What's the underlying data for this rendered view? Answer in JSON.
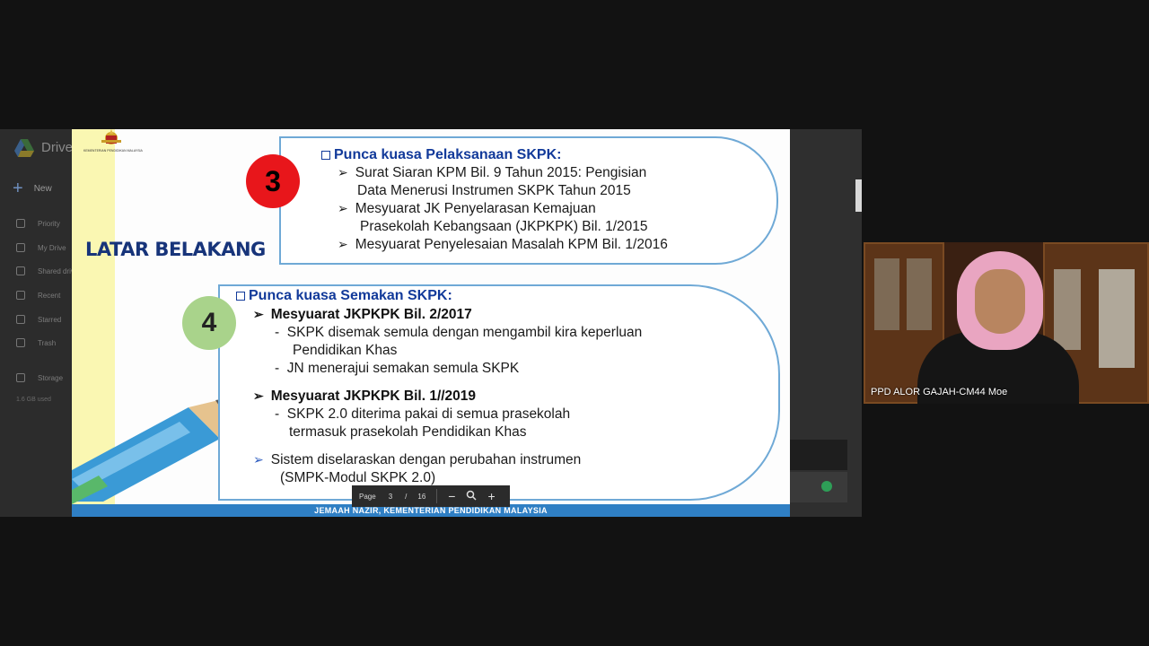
{
  "drive": {
    "title": "Drive",
    "new_label": "New",
    "sidebar": [
      "Priority",
      "My Drive",
      "Shared drives",
      "Recent",
      "Starred",
      "Trash",
      "Storage"
    ],
    "storage_used": "1.6 GB used"
  },
  "slide": {
    "footer": "JEMAAH NAZIR,  KEMENTERIAN PENDIDIKAN MALAYSIA",
    "side_title": "LATAR BELAKANG",
    "crest_text": "KEMENTERIAN PENDIDIKAN MALAYSIA",
    "section3": {
      "number": "3",
      "heading": "Punca kuasa Pelaksanaan SKPK:",
      "items": [
        [
          "Surat Siaran KPM Bil. 9 Tahun 2015: Pengisian",
          "Data Menerusi Instrumen SKPK Tahun 2015"
        ],
        [
          "Mesyuarat JK Penyelarasan Kemajuan",
          "Prasekolah Kebangsaan (JKPKPK) Bil. 1/2015"
        ],
        [
          "Mesyuarat Penyelesaian Masalah KPM Bil. 1/2016"
        ]
      ]
    },
    "section4": {
      "number": "4",
      "heading": "Punca kuasa Semakan SKPK:",
      "meeting1": "Mesyuarat JKPKPK Bil. 2/2017",
      "meeting1_points": [
        [
          "SKPK disemak semula dengan mengambil kira keperluan",
          "Pendidikan Khas"
        ],
        [
          "JN menerajui semakan semula SKPK"
        ]
      ],
      "meeting2": "Mesyuarat JKPKPK Bil. 1//2019",
      "meeting2_points": [
        [
          "SKPK 2.0 diterima pakai di semua prasekolah",
          "termasuk prasekolah Pendidikan Khas"
        ]
      ],
      "system_line1": "Sistem diselaraskan dengan perubahan instrumen",
      "system_line2": "(SMPK-Modul SKPK 2.0)"
    }
  },
  "page_nav": {
    "label": "Page",
    "current": "3",
    "separator": "/",
    "total": "16"
  },
  "webcam": {
    "participant_name": "PPD ALOR GAJAH-CM44 Moe"
  }
}
